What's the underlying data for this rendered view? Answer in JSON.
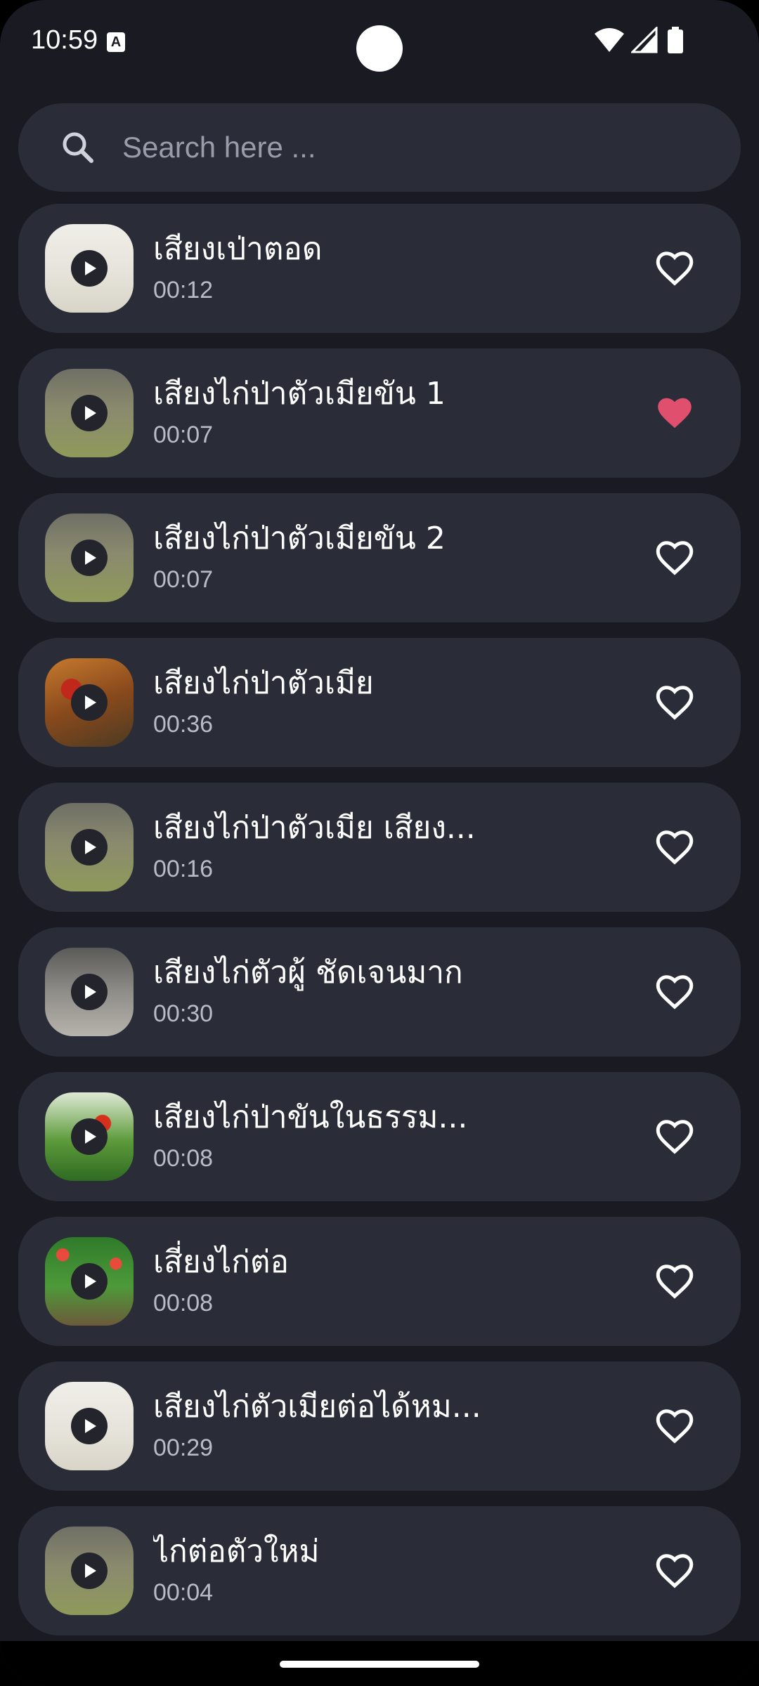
{
  "status_bar": {
    "time": "10:59",
    "notification_icon": "A",
    "icons": [
      "wifi-icon",
      "signal-icon",
      "battery-icon"
    ]
  },
  "search": {
    "placeholder": "Search here ...",
    "icon": "search-icon"
  },
  "colors": {
    "background": "#1a1b22",
    "card": "#2a2c38",
    "favorite_active": "#e0506e",
    "favorite_inactive": "#ffffff"
  },
  "sounds": [
    {
      "title": "เสียงเป่าตอด",
      "duration": "00:12",
      "favorite": false,
      "thumb": "bird-call-whistle"
    },
    {
      "title": "เสียงไก่ป่าตัวเมียขัน 1",
      "duration": "00:07",
      "favorite": true,
      "thumb": "hen"
    },
    {
      "title": "เสียงไก่ป่าตัวเมียขัน 2",
      "duration": "00:07",
      "favorite": false,
      "thumb": "hen"
    },
    {
      "title": "เสียงไก่ป่าตัวเมีย",
      "duration": "00:36",
      "favorite": false,
      "thumb": "rooster-red"
    },
    {
      "title": "เสียงไก่ป่าตัวเมีย เสียง...",
      "duration": "00:16",
      "favorite": false,
      "thumb": "hen"
    },
    {
      "title": "เสียงไก่ตัวผู้ ชัดเจนมาก",
      "duration": "00:30",
      "favorite": false,
      "thumb": "hen-grey"
    },
    {
      "title": "เสียงไก่ป่าขันในธรรม...",
      "duration": "00:08",
      "favorite": false,
      "thumb": "rooster-grass"
    },
    {
      "title": "เสี่ยงไก่ต่อ",
      "duration": "00:08",
      "favorite": false,
      "thumb": "rooster-flowers"
    },
    {
      "title": "เสียงไก่ตัวเมียต่อได้หม...",
      "duration": "00:29",
      "favorite": false,
      "thumb": "bird-call-whistle"
    },
    {
      "title": "ไก่ต่อตัวใหม่",
      "duration": "00:04",
      "favorite": false,
      "thumb": "hen"
    }
  ]
}
